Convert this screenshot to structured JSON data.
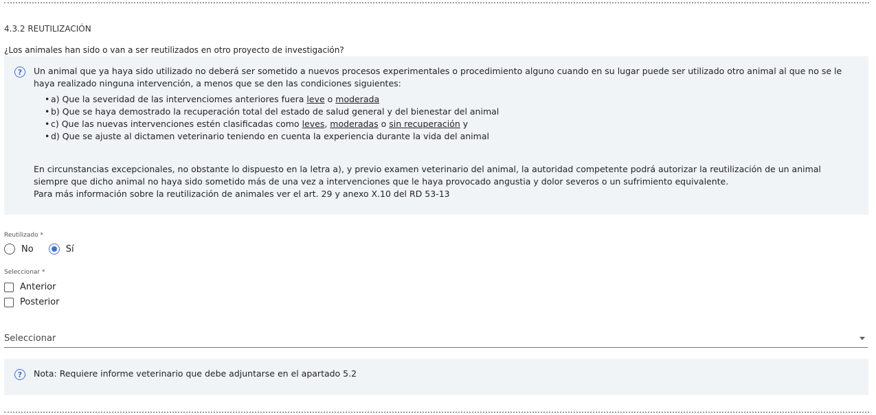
{
  "section_title": "4.3.2 REUTILIZACIÓN",
  "question": "¿Los animales han sido o van a ser reutilizados en otro proyecto de investigación?",
  "info": {
    "intro": "Un animal que ya haya sido utilizado no deberá ser sometido a nuevos procesos experimentales o procedimiento alguno cuando en su lugar puede ser utilizado otro animal al que no se le haya realizado ninguna intervención, a menos que se den las condiciones siguientes:",
    "items": [
      {
        "pre": "a) Que la severidad de las intervenciomes anteriores fuera ",
        "u1": "leve",
        "mid": " o ",
        "u2": "moderada",
        "post": ""
      },
      {
        "pre": "b) Que se haya demostrado la recuperación total del estado de salud general y del bienestar del animal"
      },
      {
        "pre": "c) Que las nuevas intervenciones estén clasificadas como ",
        "u1": "leves",
        "mid": ", ",
        "u2": "moderadas",
        "mid2": " o ",
        "u3": "sin recuperación",
        "post": " y"
      },
      {
        "pre": "d) Que se ajuste al dictamen veterinario teniendo en cuenta la experiencia durante la vida del animal"
      }
    ],
    "para1": "En circunstancias excepcionales, no obstante lo dispuesto en la letra a), y previo examen veterinario del animal, la autoridad competente podrá autorizar la reutilización de un animal siempre que dicho animal no haya sido sometido más de una vez a intervenciones que le haya provocado angustia y dolor severos o un sufrimiento equivalente.",
    "para2": "Para más información sobre la reutilización de animales ver el art. 29 y anexo X.10 del RD 53-13"
  },
  "reutilizado": {
    "label": "Reutilizado *",
    "options": [
      "No",
      "Sí"
    ],
    "selected": "Sí"
  },
  "seleccionar": {
    "label": "Seleccionar *",
    "options": [
      "Anterior",
      "Posterior"
    ]
  },
  "select_dropdown": {
    "value": "Seleccionar"
  },
  "note": "Nota: Requiere informe veterinario que debe adjuntarse en el apartado 5.2",
  "colors": {
    "accent": "#3f6fd6",
    "info_bg": "#f1f4f7"
  }
}
